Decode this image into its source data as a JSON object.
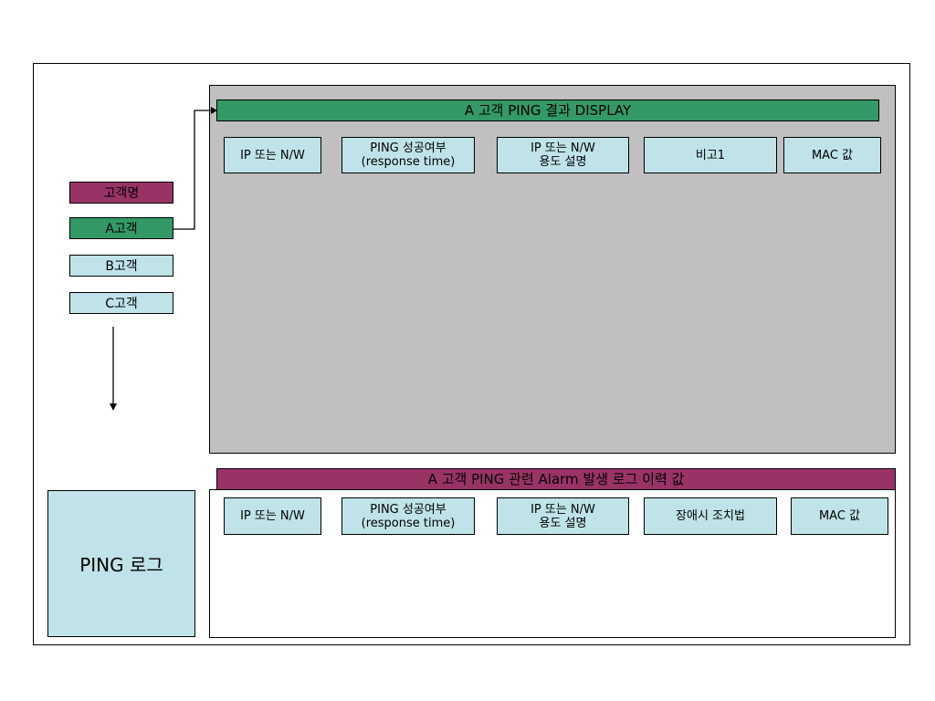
{
  "top_panel": {
    "title": "A 고객 PING 결과 DISPLAY",
    "columns": [
      "IP 또는 N/W",
      "PING 성공여부\n(response time)",
      "IP 또는 N/W\n용도 설명",
      "비고1",
      "MAC 값"
    ]
  },
  "bottom_panel": {
    "title": "A  고객 PING 관련 Alarm 발생 로그 이력 값",
    "columns": [
      "IP 또는 N/W",
      "PING 성공여부\n(response time)",
      "IP 또는 N/W\n용도 설명",
      "장애시 조치법",
      "MAC 값"
    ]
  },
  "customer_list": {
    "header": "고객명",
    "items": [
      "A고객",
      "B고객",
      "C고객"
    ]
  },
  "ping_log": {
    "label": "PING 로그"
  },
  "colors": {
    "green": "#339966",
    "maroon": "#993366",
    "light_blue": "#bfe3e8",
    "gray_panel": "#c0c0c0"
  }
}
